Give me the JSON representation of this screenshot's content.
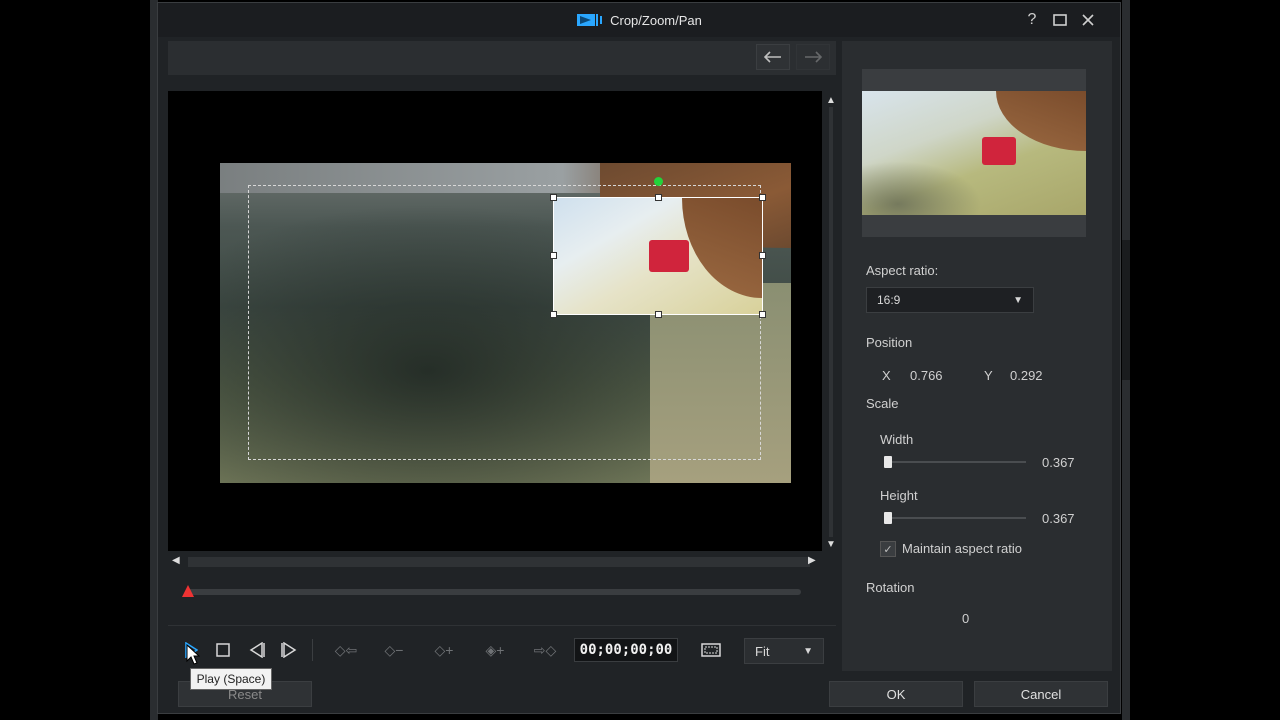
{
  "window": {
    "title": "Crop/Zoom/Pan",
    "help_icon": "question-icon",
    "maximize_icon": "maximize-icon",
    "close_icon": "close-icon"
  },
  "toolbar": {
    "undo_icon": "undo-icon",
    "redo_icon": "redo-icon"
  },
  "playback": {
    "timecode": "00;00;00;00",
    "zoom_value": "Fit",
    "tooltip": "Play (Space)"
  },
  "properties": {
    "aspect_label": "Aspect ratio:",
    "aspect_value": "16:9",
    "position_label": "Position",
    "x_label": "X",
    "x_value": "0.766",
    "y_label": "Y",
    "y_value": "0.292",
    "scale_label": "Scale",
    "width_label": "Width",
    "width_value": "0.367",
    "height_label": "Height",
    "height_value": "0.367",
    "maintain_label": "Maintain aspect ratio",
    "maintain_checked": true,
    "rotation_label": "Rotation",
    "rotation_value": "0"
  },
  "buttons": {
    "reset": "Reset",
    "ok": "OK",
    "cancel": "Cancel"
  },
  "colors": {
    "accent_handle": "#22d33a",
    "playhead": "#ee3333",
    "title_icon_blue": "#2aa7ff"
  }
}
